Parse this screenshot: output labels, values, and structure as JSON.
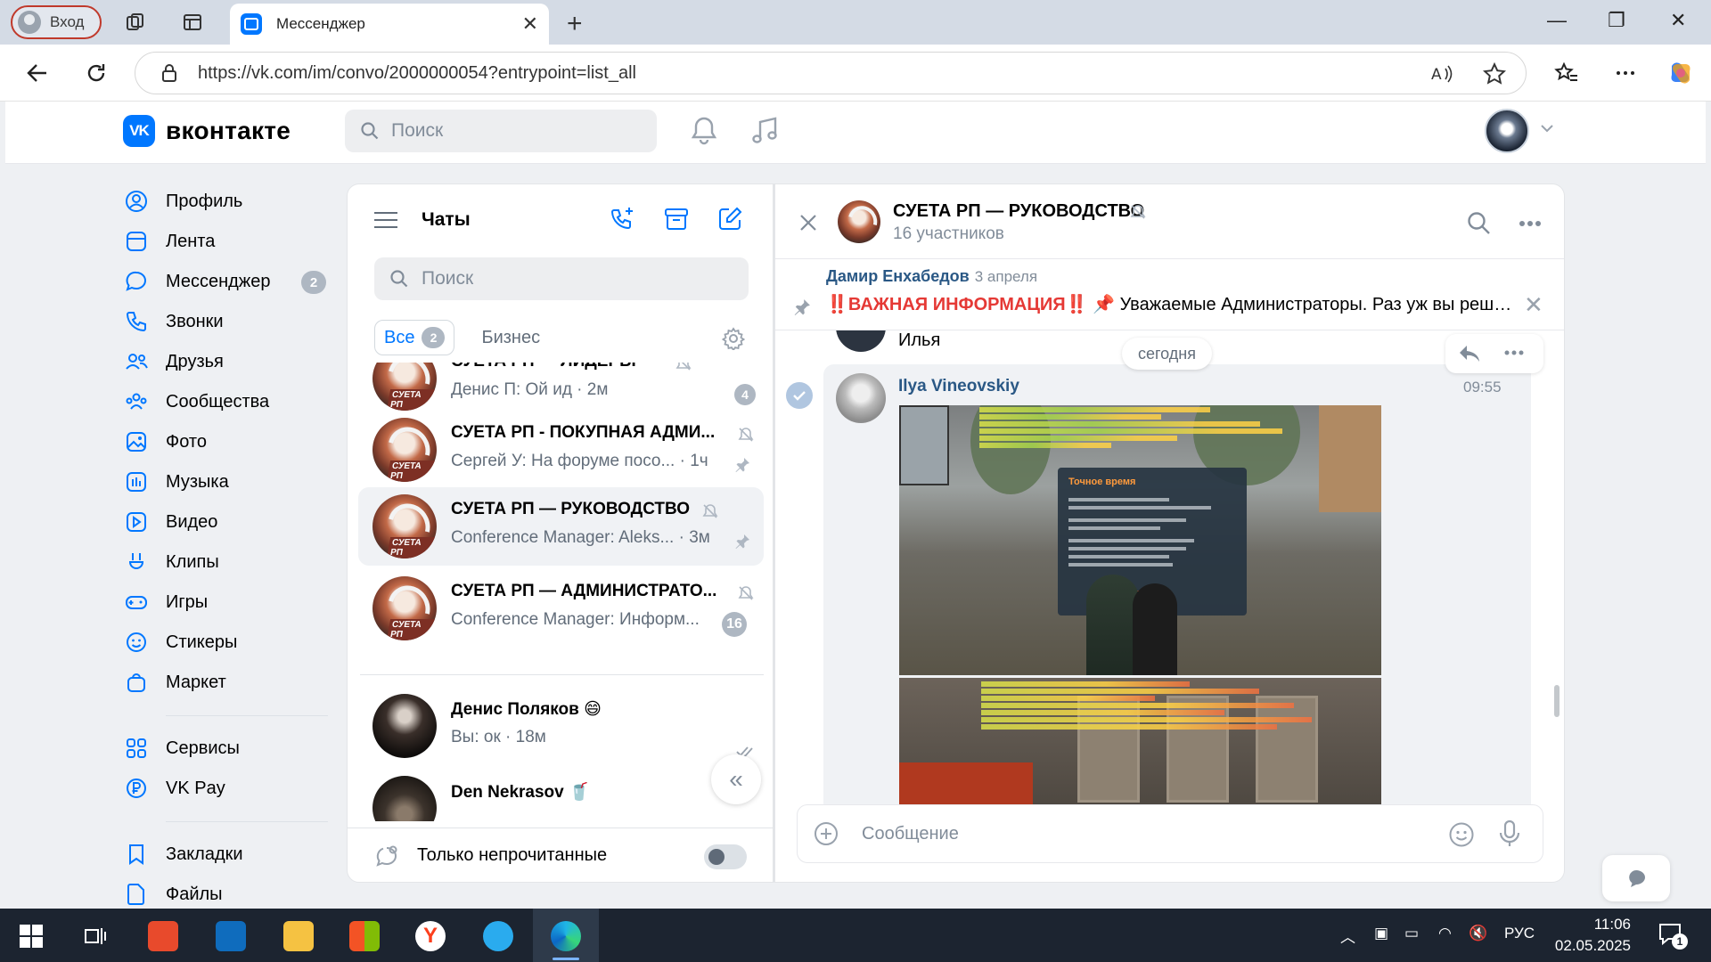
{
  "browser": {
    "profile_label": "Вход",
    "tab_title": "Мессенджер",
    "tab_close": "✕",
    "new_tab": "+",
    "window_controls": [
      "—",
      "❐",
      "✕"
    ],
    "url": "https://vk.com/im/convo/2000000054?entrypoint=list_all"
  },
  "vk": {
    "logo_text": "вконтакте",
    "logo_mark": "VK",
    "search_placeholder": "Поиск",
    "accent": "#0077ff"
  },
  "left_menu": {
    "items": [
      {
        "label": "Профиль",
        "icon": "profile-icon"
      },
      {
        "label": "Лента",
        "icon": "feed-icon"
      },
      {
        "label": "Мессенджер",
        "icon": "messenger-icon",
        "badge": "2"
      },
      {
        "label": "Звонки",
        "icon": "phone-icon"
      },
      {
        "label": "Друзья",
        "icon": "friends-icon"
      },
      {
        "label": "Сообщества",
        "icon": "communities-icon"
      },
      {
        "label": "Фото",
        "icon": "photo-icon"
      },
      {
        "label": "Музыка",
        "icon": "music-icon"
      },
      {
        "label": "Видео",
        "icon": "video-icon"
      },
      {
        "label": "Клипы",
        "icon": "clips-icon"
      },
      {
        "label": "Игры",
        "icon": "games-icon"
      },
      {
        "label": "Стикеры",
        "icon": "stickers-icon"
      },
      {
        "label": "Маркет",
        "icon": "market-icon"
      }
    ],
    "services": [
      {
        "label": "Сервисы",
        "icon": "services-icon"
      },
      {
        "label": "VK Pay",
        "icon": "vkpay-icon"
      }
    ],
    "extra": [
      {
        "label": "Закладки",
        "icon": "bookmark-icon"
      },
      {
        "label": "Файлы",
        "icon": "files-icon"
      }
    ]
  },
  "chats": {
    "title": "Чаты",
    "search_placeholder": "Поиск",
    "filter_all": "Все",
    "filter_all_count": "2",
    "filter_business": "Бизнес",
    "items": [
      {
        "name": "СУЕТА РП — ЛИДЕРЫ",
        "preview": "Денис П: Ой ид · 2м",
        "unread": "4",
        "muted": true
      },
      {
        "name": "СУЕТА РП - ПОКУПНАЯ АДМИ...",
        "preview": "Сергей У: На форуме посо... · 1ч",
        "pinned": true,
        "muted": true
      },
      {
        "name": "СУЕТА РП — РУКОВОДСТВО",
        "preview": "Conference Manager: Aleks... · 3м",
        "pinned": true,
        "muted": true,
        "selected": true
      },
      {
        "name": "СУЕТА РП — АДМИНИСТРАТО...",
        "preview": "Conference Manager: Информ...",
        "unread": "16",
        "muted": true
      },
      {
        "name": "Денис Поляков 😄",
        "preview": "Вы: ок · 18м"
      },
      {
        "name": "Den Nekrasov 🥤",
        "preview": ""
      }
    ],
    "avatar_label": "СУЕТА РП",
    "unread_only_label": "Только непрочитанные",
    "unread_only_on": false
  },
  "convo": {
    "title": "СУЕТА РП — РУКОВОДСТВО",
    "subtitle": "16 участников",
    "pinned_author": "Дамир Енхабедов",
    "pinned_date": "3 апреля",
    "pinned_alert": "‼️ВАЖНАЯ ИНФОРМАЦИЯ‼️",
    "pinned_text": "📌 Уважаемые Администраторы. Раз уж вы реши...",
    "prev_author": "Илья",
    "date_chip": "сегодня",
    "message_author": "Ilya Vineovskiy",
    "message_time": "09:55",
    "composer_placeholder": "Сообщение",
    "game_dialog_title": "Точное время"
  },
  "taskbar": {
    "lang": "РУС",
    "time": "11:06",
    "date": "02.05.2025",
    "notifications": "1"
  }
}
